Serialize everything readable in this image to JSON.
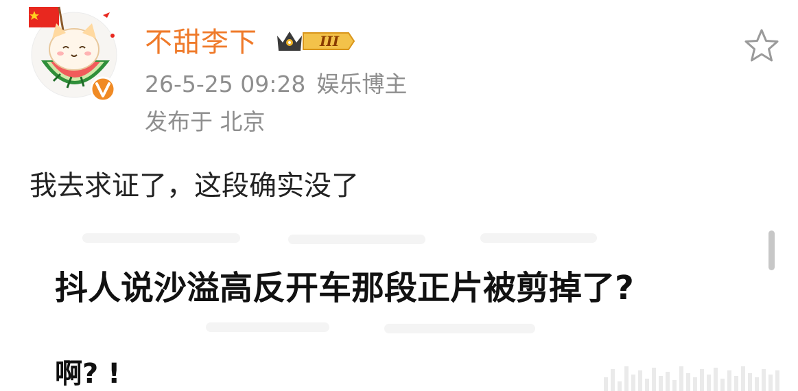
{
  "user": {
    "name": "不甜李下",
    "level": "III",
    "verified": true
  },
  "meta": {
    "timestamp": "26-5-25 09:28",
    "role": "娱乐博主",
    "location": "发布于 北京"
  },
  "post": {
    "text": "我去求证了，这段确实没了"
  },
  "embed": {
    "title": "抖人说沙溢高反开车那段正片被剪掉了?",
    "sub": "啊? !"
  },
  "colors": {
    "username": "#ef7a2a",
    "meta": "#8e8e8e",
    "badge_gold": "#f0b429",
    "verified_orange": "#f08a24"
  },
  "icons": {
    "favorite": "star-outline-icon",
    "verified": "verified-v-icon",
    "level": "crown-level-icon"
  }
}
